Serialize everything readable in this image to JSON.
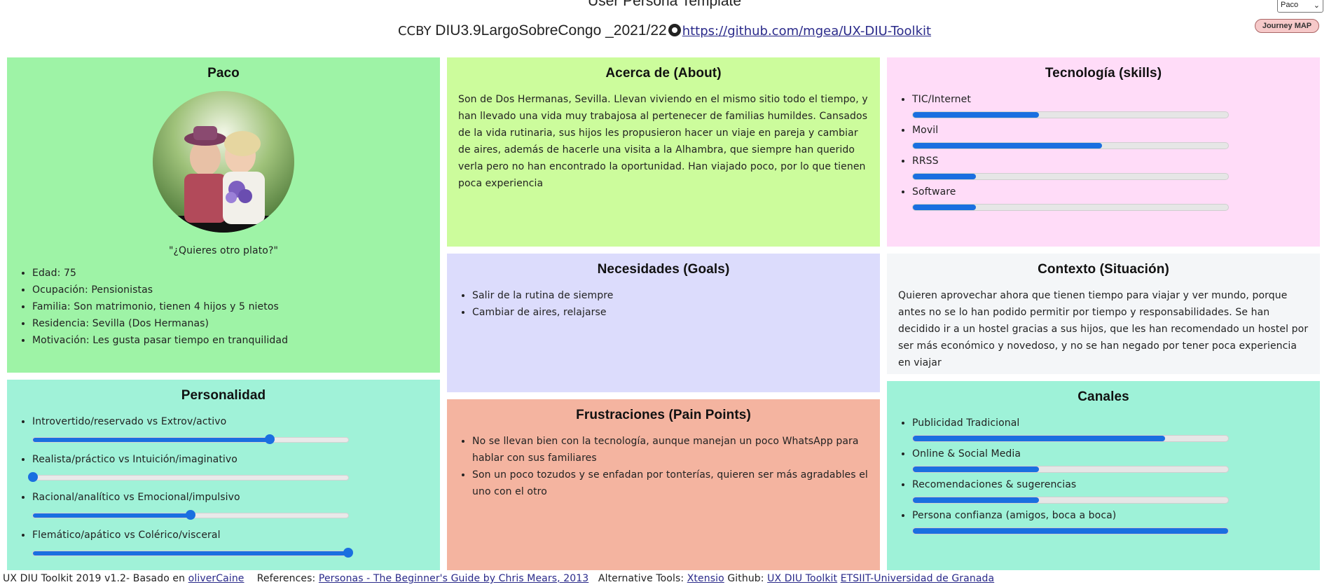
{
  "header": {
    "title": "User Persona Template",
    "license": "CCBY",
    "project": "DIU3.9LargoSobreCongo _2021/22",
    "repo_link": "https://github.com/mgea/UX-DIU-Toolkit",
    "persona_select": "Paco",
    "journey_button": "Journey MAP"
  },
  "persona": {
    "name": "Paco",
    "quote": "\"¿Quieres otro plato?\"",
    "details": [
      "Edad: 75",
      "Ocupación: Pensionistas",
      "Familia: Son matrimonio, tienen 4 hijos y 5 nietos",
      "Residencia: Sevilla (Dos Hermanas)",
      "Motivación: Les gusta pasar tiempo en tranquilidad"
    ]
  },
  "about": {
    "title": "Acerca de (About)",
    "text": "Son de Dos Hermanas, Sevilla. Llevan viviendo en el mismo sitio todo el tiempo, y han llevado una vida muy trabajosa al pertenecer de familias humildes. Cansados de la vida rutinaria, sus hijos les propusieron hacer un viaje en pareja y cambiar de aires, además de hacerle una visita a la Alhambra, que siempre han querido verla pero no han encontrado la oportunidad. Han viajado poco, por lo que tienen poca experiencia"
  },
  "skills": {
    "title": "Tecnología (skills)",
    "items": [
      {
        "label": "TIC/Internet",
        "value": 0.4
      },
      {
        "label": "Movil",
        "value": 0.6
      },
      {
        "label": "RRSS",
        "value": 0.2
      },
      {
        "label": "Software",
        "value": 0.2
      }
    ]
  },
  "goals": {
    "title": "Necesidades (Goals)",
    "items": [
      "Salir de la rutina de siempre",
      "Cambiar de aires, relajarse"
    ]
  },
  "context": {
    "title": "Contexto (Situación)",
    "text": "Quieren aprovechar ahora que tienen tiempo para viajar y ver mundo, porque antes no se lo han podido permitir por tiempo y responsabilidades. Se han decidido ir a un hostel gracias a sus hijos, que les han recomendado un hostel por ser más económico y novedoso, y no se han negado por tener poca experiencia en viajar"
  },
  "personality": {
    "title": "Personalidad",
    "items": [
      {
        "label": "Introvertido/reservado vs Extrov/activo",
        "value": 0.75
      },
      {
        "label": "Realista/práctico vs Intuición/imaginativo",
        "value": 0.0
      },
      {
        "label": "Racional/analítico vs Emocional/impulsivo",
        "value": 0.5
      },
      {
        "label": "Flemático/apático vs Colérico/visceral",
        "value": 1.0
      }
    ]
  },
  "pain_points": {
    "title": "Frustraciones (Pain Points)",
    "items": [
      "No se llevan bien con la tecnología, aunque manejan un poco WhatsApp para hablar con sus familiares",
      "Son un poco tozudos y se enfadan por tonterías, quieren ser más agradables el uno con el otro"
    ]
  },
  "channels": {
    "title": "Canales",
    "items": [
      {
        "label": "Publicidad Tradicional",
        "value": 0.8
      },
      {
        "label": "Online & Social Media",
        "value": 0.4
      },
      {
        "label": "Recomendaciones & sugerencias",
        "value": 0.4
      },
      {
        "label": "Persona confianza (amigos, boca a boca)",
        "value": 1.0
      }
    ]
  },
  "footer": {
    "toolkit": "UX DIU Toolkit 2019 v1.2- Basado en",
    "toolkit_link": "oliverCaine",
    "references": "References:",
    "references_link": "Personas - The Beginner's Guide by Chris Mears, 2013",
    "alt_tools": "Alternative Tools:",
    "alt_tools_link": "Xtensio",
    "github": "Github:",
    "github_link": "UX DIU Toolkit",
    "university_link": "ETSIIT-Universidad de Granada"
  },
  "colors": {
    "persona_bg": "#9ef3a6",
    "about_bg": "#ccfc9c",
    "skills_bg": "#ffdcf8",
    "goals_bg": "#dcdcfc",
    "context_bg": "#f4f6f8",
    "personality_bg": "#a0f2d8",
    "pain_bg": "#f4b4a0",
    "channels_bg": "#9ef2d8",
    "bar_fill": "#1a6fe0"
  }
}
